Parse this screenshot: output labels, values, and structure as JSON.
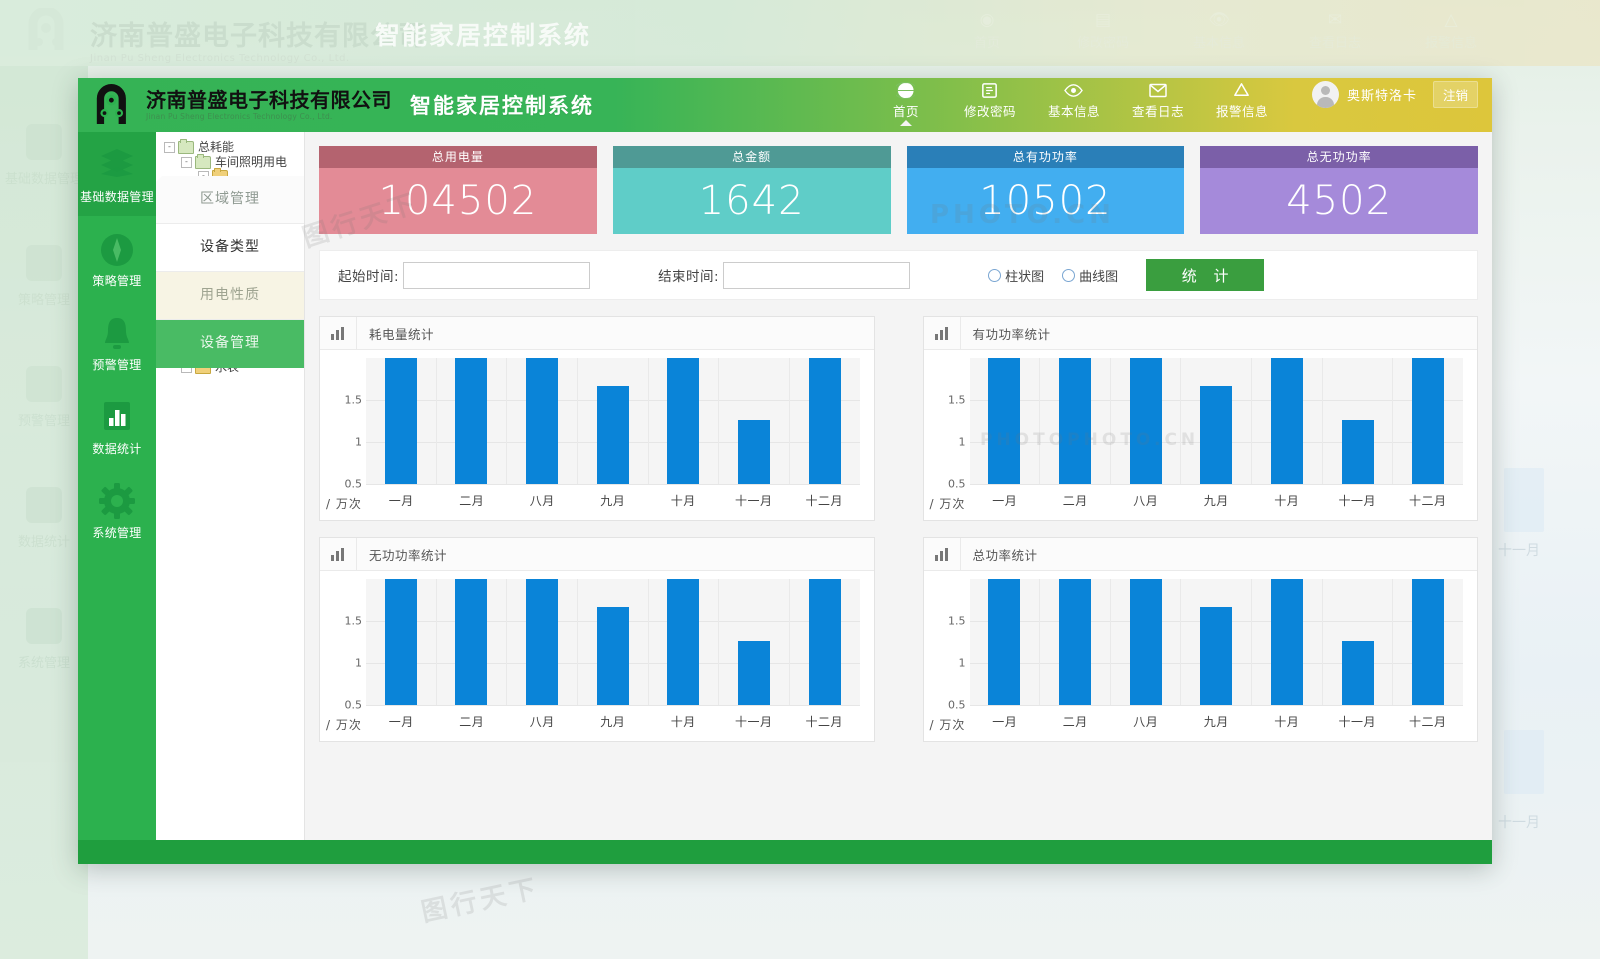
{
  "brand": {
    "company_cn": "济南普盛电子科技有限公司",
    "company_en": "Jinan Pu Sheng Electronics Technology Co., Ltd.",
    "system_name": "智能家居控制系统",
    "logo_icon": "circuit-logo-icon"
  },
  "topnav": {
    "items": [
      {
        "label": "首页",
        "icon": "globe-icon",
        "active": true
      },
      {
        "label": "修改密码",
        "icon": "password-icon",
        "active": false
      },
      {
        "label": "基本信息",
        "icon": "eye-icon",
        "active": false
      },
      {
        "label": "查看日志",
        "icon": "envelope-icon",
        "active": false
      },
      {
        "label": "报警信息",
        "icon": "bell-alert-icon",
        "active": false
      }
    ],
    "user_name": "奥斯特洛卡",
    "logout_label": "注销",
    "avatar_icon": "user-avatar-icon"
  },
  "rail": {
    "items": [
      {
        "label": "基础数据管理",
        "icon": "layers-icon",
        "active": true
      },
      {
        "label": "策略管理",
        "icon": "compass-icon",
        "active": false
      },
      {
        "label": "预警管理",
        "icon": "bell-icon",
        "active": false
      },
      {
        "label": "数据统计",
        "icon": "bar-chart-icon",
        "active": false
      },
      {
        "label": "系统管理",
        "icon": "gear-icon",
        "active": false
      }
    ]
  },
  "subnav": {
    "tree": [
      {
        "label": "总耗能",
        "level": 1,
        "expander": "-",
        "folder": "open"
      },
      {
        "label": "车间照明用电",
        "level": 2,
        "expander": "-",
        "folder": "open"
      },
      {
        "label": "水表",
        "level": 2,
        "expander": "-",
        "folder": "closed"
      }
    ],
    "menu": [
      {
        "label": "区域管理",
        "style": "plain",
        "active": false
      },
      {
        "label": "设备类型",
        "style": "white",
        "active": false
      },
      {
        "label": "用电性质",
        "style": "cream",
        "active": false
      },
      {
        "label": "设备管理",
        "style": "active",
        "active": true
      }
    ]
  },
  "stats": [
    {
      "title": "总用电量",
      "value": "104502",
      "head_color": "#b4636f",
      "body_color": "#e38b96"
    },
    {
      "title": "总金额",
      "value": "1642",
      "head_color": "#4f9a95",
      "body_color": "#5fcdc8"
    },
    {
      "title": "总有功功率",
      "value": "10502",
      "head_color": "#2a7fb8",
      "body_color": "#42aef0"
    },
    {
      "title": "总无功功率",
      "value": "4502",
      "head_color": "#7b5fa8",
      "body_color": "#a58ada"
    }
  ],
  "filter": {
    "start_label": "起始时间:",
    "start_value": "",
    "start_placeholder": "",
    "end_label": "结束时间:",
    "end_value": "",
    "end_placeholder": "",
    "radio_bar": "柱状图",
    "radio_line": "曲线图",
    "submit_label": "统 计",
    "submit_color": "#3a9e3f"
  },
  "chart_data": [
    {
      "type": "bar",
      "title": "耗电量统计",
      "xlabel": "",
      "ylabel": "/ 万次",
      "unit": "/ 万次",
      "categories": [
        "一月",
        "二月",
        "八月",
        "九月",
        "十月",
        "十一月",
        "十二月"
      ],
      "values": [
        2.0,
        2.0,
        2.0,
        1.67,
        2.0,
        1.26,
        2.0
      ],
      "yticks": [
        "1.5",
        "1",
        "0.5"
      ],
      "ylim": [
        0.5,
        2.0
      ],
      "grid": true,
      "bar_color": "#0a84d8",
      "legend": "none"
    },
    {
      "type": "bar",
      "title": "有功功率统计",
      "xlabel": "",
      "ylabel": "/ 万次",
      "unit": "/ 万次",
      "categories": [
        "一月",
        "二月",
        "八月",
        "九月",
        "十月",
        "十一月",
        "十二月"
      ],
      "values": [
        2.0,
        2.0,
        2.0,
        1.67,
        2.0,
        1.26,
        2.0
      ],
      "yticks": [
        "1.5",
        "1",
        "0.5"
      ],
      "ylim": [
        0.5,
        2.0
      ],
      "grid": true,
      "bar_color": "#0a84d8",
      "legend": "none"
    },
    {
      "type": "bar",
      "title": "无功功率统计",
      "xlabel": "",
      "ylabel": "/ 万次",
      "unit": "/ 万次",
      "categories": [
        "一月",
        "二月",
        "八月",
        "九月",
        "十月",
        "十一月",
        "十二月"
      ],
      "values": [
        2.0,
        2.0,
        2.0,
        1.67,
        2.0,
        1.26,
        2.0
      ],
      "yticks": [
        "1.5",
        "1",
        "0.5"
      ],
      "ylim": [
        0.5,
        2.0
      ],
      "grid": true,
      "bar_color": "#0a84d8",
      "legend": "none"
    },
    {
      "type": "bar",
      "title": "总功率统计",
      "xlabel": "",
      "ylabel": "/ 万次",
      "unit": "/ 万次",
      "categories": [
        "一月",
        "二月",
        "八月",
        "九月",
        "十月",
        "十一月",
        "十二月"
      ],
      "values": [
        2.0,
        2.0,
        2.0,
        1.67,
        2.0,
        1.26,
        2.0
      ],
      "yticks": [
        "1.5",
        "1",
        "0.5"
      ],
      "ylim": [
        0.5,
        2.0
      ],
      "grid": true,
      "bar_color": "#0a84d8",
      "legend": "none"
    }
  ]
}
